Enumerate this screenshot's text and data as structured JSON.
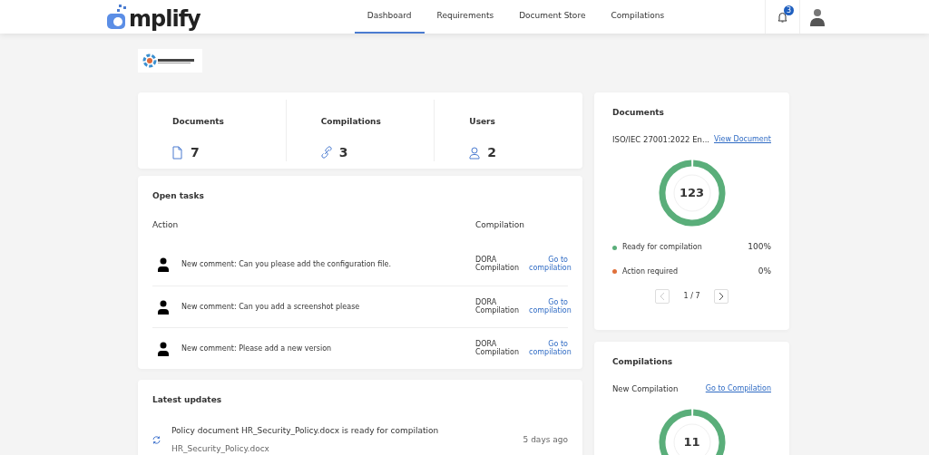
{
  "header": {
    "logo": "mplify",
    "nav": [
      {
        "label": "Dashboard",
        "selected": true
      },
      {
        "label": "Requirements",
        "selected": false
      },
      {
        "label": "Document Store",
        "selected": false
      },
      {
        "label": "Compilations",
        "selected": false
      }
    ],
    "notifications": "3"
  },
  "stats": [
    {
      "kind": "document",
      "label": "Documents",
      "value": "7"
    },
    {
      "kind": "link",
      "label": "Compilations",
      "value": "3"
    },
    {
      "kind": "user",
      "label": "Users",
      "value": "2"
    }
  ],
  "open_tasks": {
    "title": "Open tasks",
    "columns": [
      "Action",
      "Compilation"
    ],
    "rows": [
      {
        "action": "New comment: Can you please add the configuration file.",
        "compilation": "DORA Compilation",
        "link": "Go to compilation"
      },
      {
        "action": "New comment: Can you add a screenshot please",
        "compilation": "DORA Compilation",
        "link": "Go to compilation"
      },
      {
        "action": "New comment: Please add a new version",
        "compilation": "DORA Compilation",
        "link": "Go to compilation"
      }
    ]
  },
  "latest_updates": {
    "title": "Latest updates",
    "items": [
      {
        "text": "Policy document HR_Security_Policy.docx is ready for compilation",
        "file": "HR_Security_Policy.docx",
        "time": "5 days ago"
      }
    ]
  },
  "documents_panel": {
    "title": "Documents",
    "name": "ISO/IEC 27001:2022 En...",
    "link": "View Document",
    "total": "123",
    "legend": [
      {
        "label": "Ready for compilation",
        "value": "100%",
        "color": "#5aae7a"
      },
      {
        "label": "Action required",
        "value": "0%",
        "color": "#e0703a"
      }
    ],
    "pager": {
      "text": "1 / 7",
      "prev_disabled": true,
      "next_disabled": false
    }
  },
  "compilations_panel": {
    "title": "Compilations",
    "name": "New Compilation",
    "link": "Go to Compilation",
    "total": "11"
  }
}
